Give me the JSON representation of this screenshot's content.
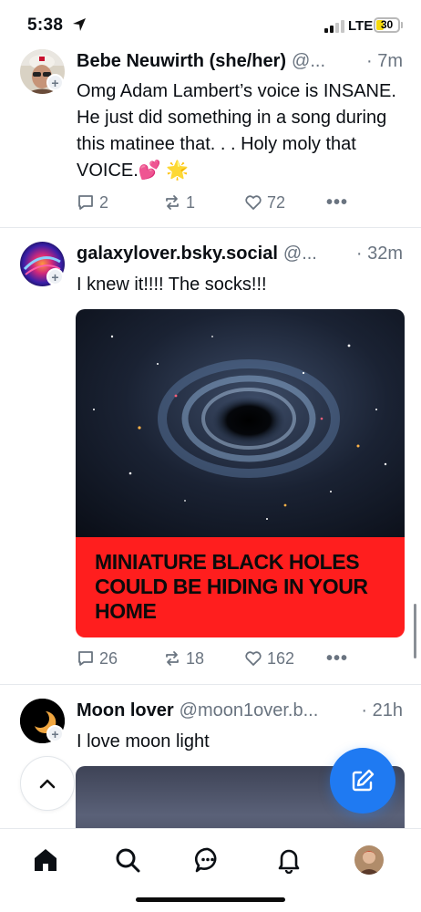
{
  "status_bar": {
    "time": "5:38",
    "network": "LTE",
    "battery": "30",
    "battery_level": 0.3
  },
  "posts": [
    {
      "author": "Bebe Neuwirth (she/her)",
      "handle": "@...",
      "time": "· 7m",
      "text": "Omg Adam Lambert’s voice is INSANE. He just did something in a song during this matinee that. . . Holy moly that VOICE.💕 🌟",
      "replies": "2",
      "reposts": "1",
      "likes": "72"
    },
    {
      "author": "galaxylover.bsky.social",
      "handle": "@...",
      "time": "· 32m",
      "text": "I knew it!!!! The socks!!!",
      "image_caption": "MINIATURE BLACK HOLES COULD BE HIDING IN YOUR HOME",
      "replies": "26",
      "reposts": "18",
      "likes": "162"
    },
    {
      "author": "Moon lover",
      "handle": "@moon1over.b...",
      "time": "· 21h",
      "text": "I love moon light"
    }
  ],
  "colors": {
    "accent": "#1f7af2",
    "caption_bg": "#ff1e1e",
    "muted": "#6a7480"
  },
  "icons": {
    "reply": "reply-icon",
    "repost": "repost-icon",
    "like": "heart-icon",
    "more": "more-icon",
    "compose": "compose-icon",
    "scroll_top": "chevron-up-icon",
    "nav": [
      "home-icon",
      "search-icon",
      "chat-icon",
      "bell-icon",
      "profile-avatar"
    ]
  }
}
